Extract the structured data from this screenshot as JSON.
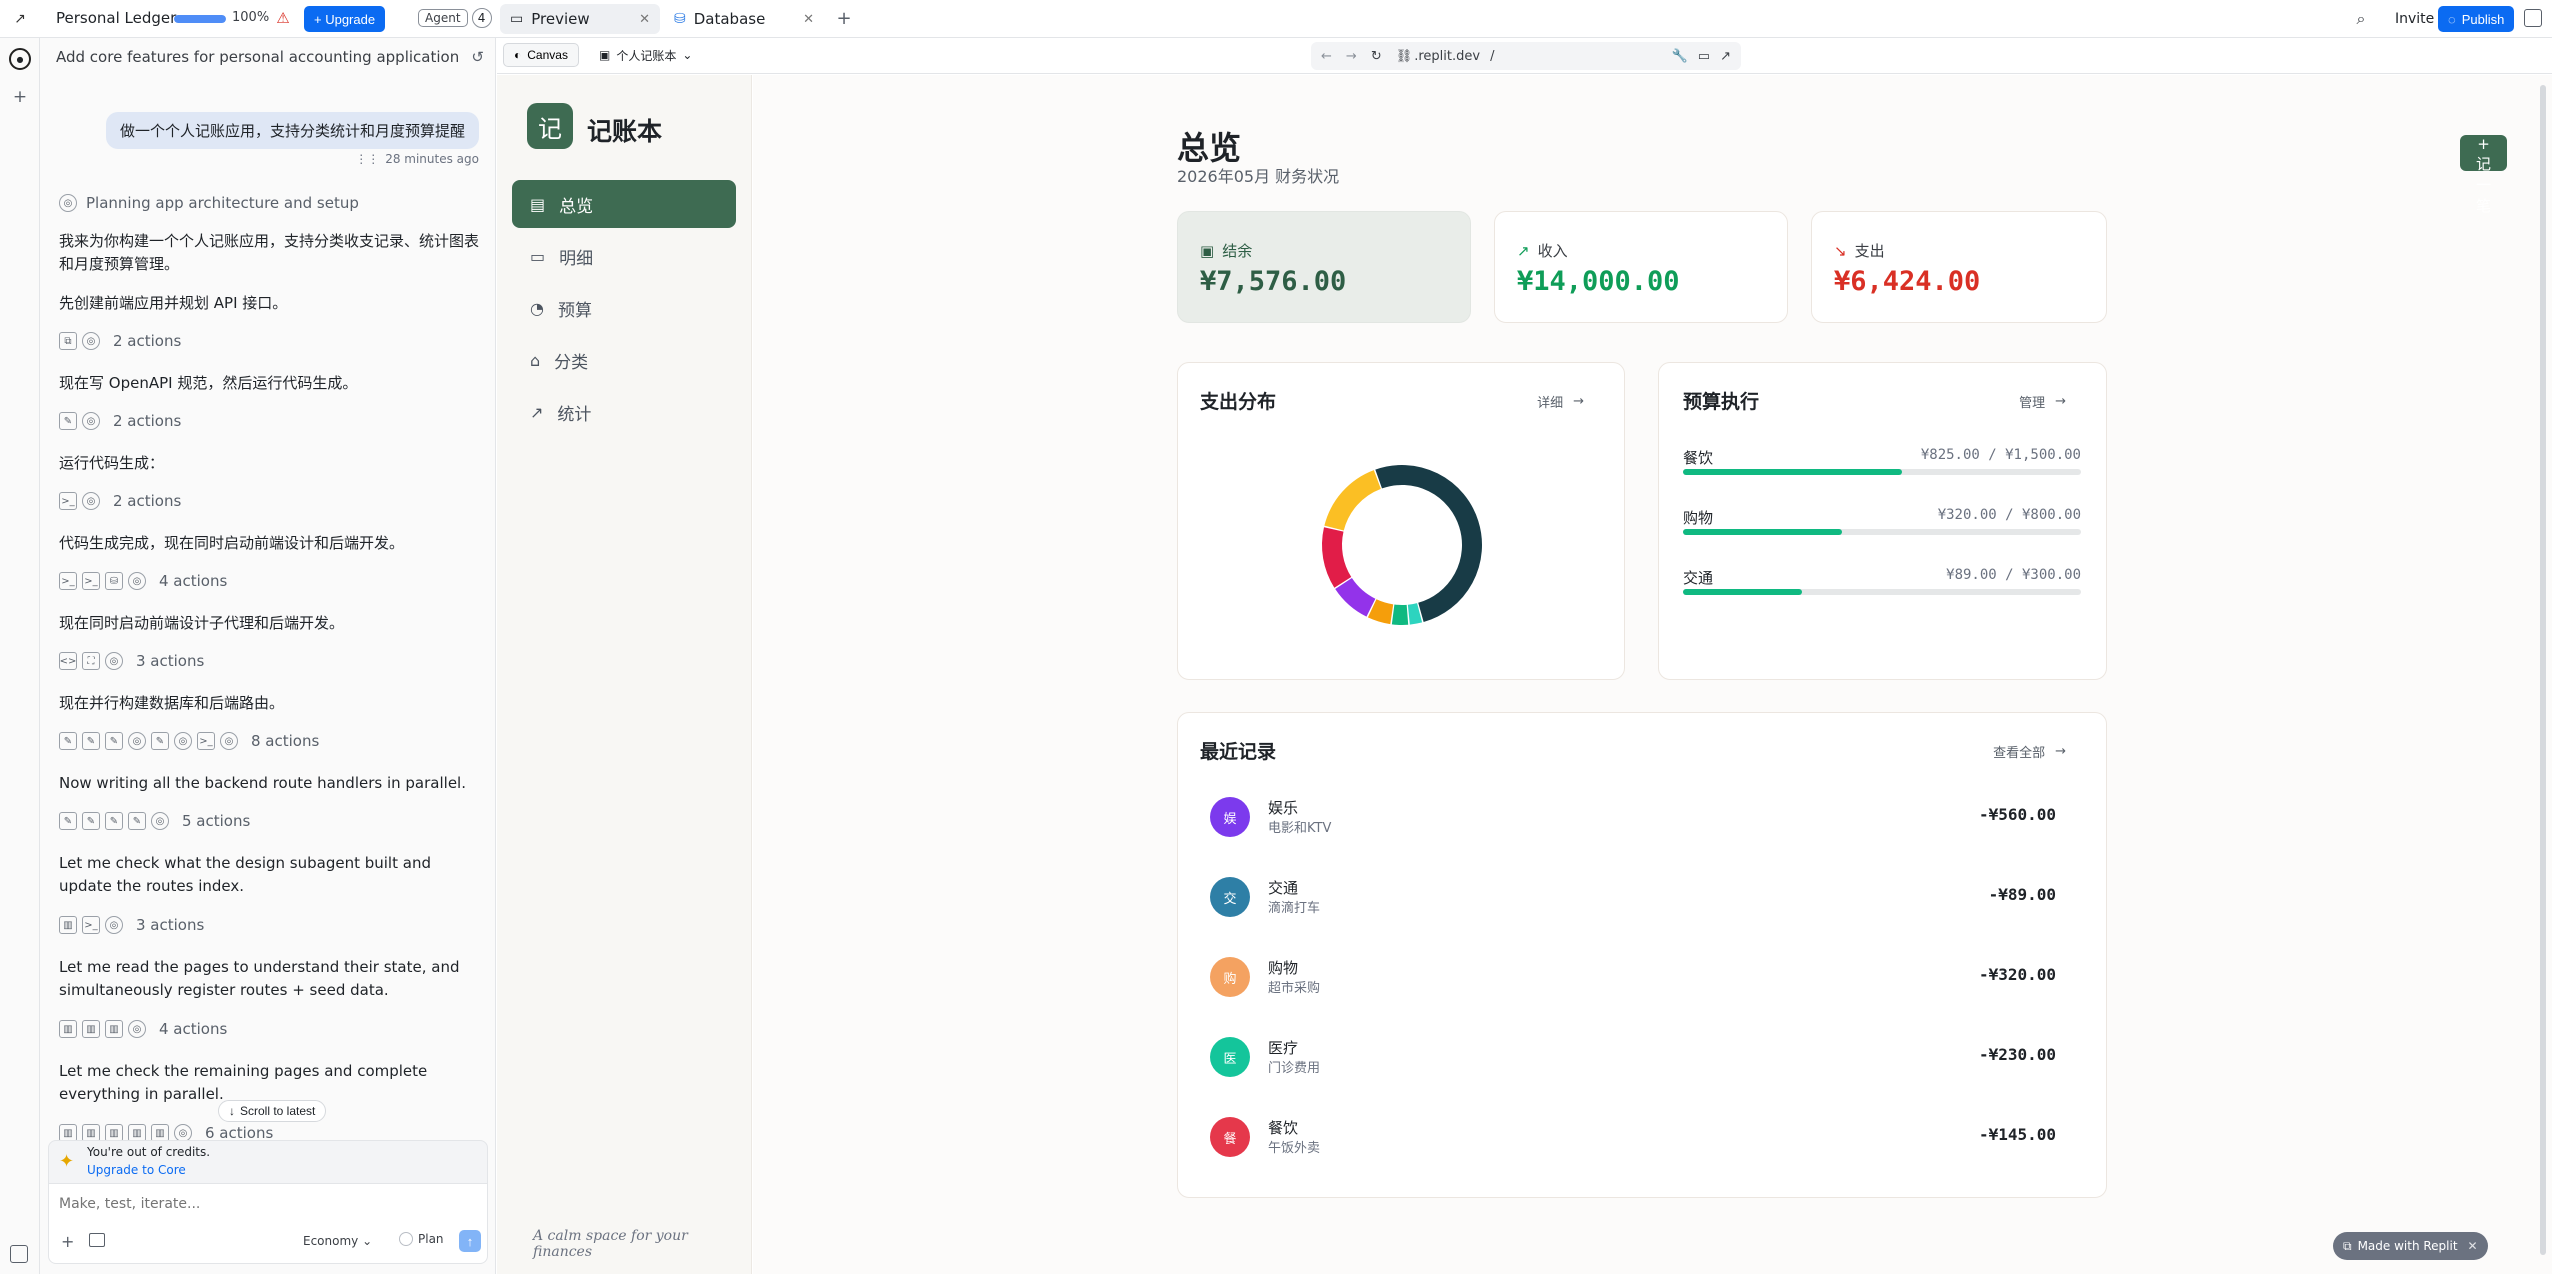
{
  "topbar": {
    "project_name": "Personal Ledger",
    "progress_percent": 100,
    "progress_label": "100%",
    "upgrade_label": "+ Upgrade",
    "agent_label": "Agent",
    "agent_count": "4",
    "tabs": [
      {
        "label": "Preview"
      },
      {
        "label": "Database"
      }
    ],
    "invite_label": "Invite",
    "publish_label": "Publish"
  },
  "chat": {
    "header_title": "Add core features for personal accounting application",
    "user_message": "做一个个人记账应用，支持分类统计和月度预算提醒",
    "user_message_time": "28 minutes ago",
    "planning_label": "Planning app architecture and setup",
    "messages": [
      {
        "text": "我来为你构建一个个人记账应用，支持分类收支记录、统计图表和月度预算管理。"
      },
      {
        "text": "先创建前端应用并规划 API 接口。",
        "actions": "2 actions"
      },
      {
        "text": "现在写 OpenAPI 规范，然后运行代码生成。",
        "actions": "2 actions"
      },
      {
        "text": "运行代码生成：",
        "actions": "2 actions"
      },
      {
        "text": "代码生成完成，现在同时启动前端设计和后端开发。",
        "actions": "4 actions"
      },
      {
        "text": "现在同时启动前端设计子代理和后端开发。",
        "actions": "3 actions"
      },
      {
        "text": "现在并行构建数据库和后端路由。",
        "actions": "8 actions"
      },
      {
        "text": "Now writing all the backend route handlers in parallel.",
        "actions": "5 actions"
      },
      {
        "text": "Let me check what the design subagent built and update the routes index.",
        "actions": "3 actions"
      },
      {
        "text": "Let me read the pages to understand their state, and simultaneously register routes + seed data.",
        "actions": "4 actions"
      },
      {
        "text": "Let me check the remaining pages and complete everything in parallel.",
        "actions": "6 actions"
      }
    ],
    "scroll_latest_label": "Scroll to latest",
    "credits_title": "You're out of credits.",
    "credits_link": "Upgrade to Core",
    "input_placeholder": "Make, test, iterate...",
    "economy_label": "Economy",
    "plan_label": "Plan"
  },
  "preview_toolbar": {
    "canvas_label": "Canvas",
    "project_selector": "个人记账本",
    "url_host": ".replit.dev",
    "url_path": "/"
  },
  "app": {
    "logo_char": "记",
    "logo_title": "记账本",
    "nav": [
      {
        "label": "总览",
        "icon": "document-icon",
        "active": true
      },
      {
        "label": "明细",
        "icon": "wallet-icon",
        "active": false
      },
      {
        "label": "预算",
        "icon": "pie-icon",
        "active": false
      },
      {
        "label": "分类",
        "icon": "tag-icon",
        "active": false
      },
      {
        "label": "统计",
        "icon": "trend-icon",
        "active": false
      }
    ],
    "footer_tagline": "A calm space for your finances",
    "page_title": "总览",
    "page_subtitle": "2026年05月 财务状况",
    "add_button": "+ 记一笔",
    "stats": {
      "balance": {
        "label": "结余",
        "value": "¥7,576.00",
        "color": "#2e5e45"
      },
      "income": {
        "label": "收入",
        "value": "¥14,000.00",
        "color": "#0f9d58"
      },
      "expense": {
        "label": "支出",
        "value": "¥6,424.00",
        "color": "#d93025"
      }
    },
    "distribution": {
      "title": "支出分布",
      "link": "详细",
      "segments": [
        {
          "value": 3300,
          "color": "#183b46"
        },
        {
          "value": 180,
          "color": "#2dd4bf"
        },
        {
          "value": 230,
          "color": "#10b981"
        },
        {
          "value": 320,
          "color": "#f59e0b"
        },
        {
          "value": 560,
          "color": "#9333ea"
        },
        {
          "value": 825,
          "color": "#e11d48"
        },
        {
          "value": 1009,
          "color": "#fbbf24"
        }
      ]
    },
    "budget": {
      "title": "预算执行",
      "link": "管理",
      "items": [
        {
          "name": "餐饮",
          "value": "¥825.00 / ¥1,500.00",
          "ratio": 0.55
        },
        {
          "name": "购物",
          "value": "¥320.00 / ¥800.00",
          "ratio": 0.4
        },
        {
          "name": "交通",
          "value": "¥89.00 / ¥300.00",
          "ratio": 0.3
        }
      ]
    },
    "recent": {
      "title": "最近记录",
      "link": "查看全部",
      "items": [
        {
          "avatar": "娱",
          "color": "#7c3aed",
          "title": "娱乐",
          "subtitle": "电影和KTV",
          "amount": "-¥560.00"
        },
        {
          "avatar": "交",
          "color": "#2e7fa6",
          "title": "交通",
          "subtitle": "滴滴打车",
          "amount": "-¥89.00"
        },
        {
          "avatar": "购",
          "color": "#f4a261",
          "title": "购物",
          "subtitle": "超市采购",
          "amount": "-¥320.00"
        },
        {
          "avatar": "医",
          "color": "#14c59b",
          "title": "医疗",
          "subtitle": "门诊费用",
          "amount": "-¥230.00"
        },
        {
          "avatar": "餐",
          "color": "#e5384b",
          "title": "餐饮",
          "subtitle": "午饭外卖",
          "amount": "-¥145.00"
        }
      ]
    },
    "made_with": "Made with Replit"
  }
}
